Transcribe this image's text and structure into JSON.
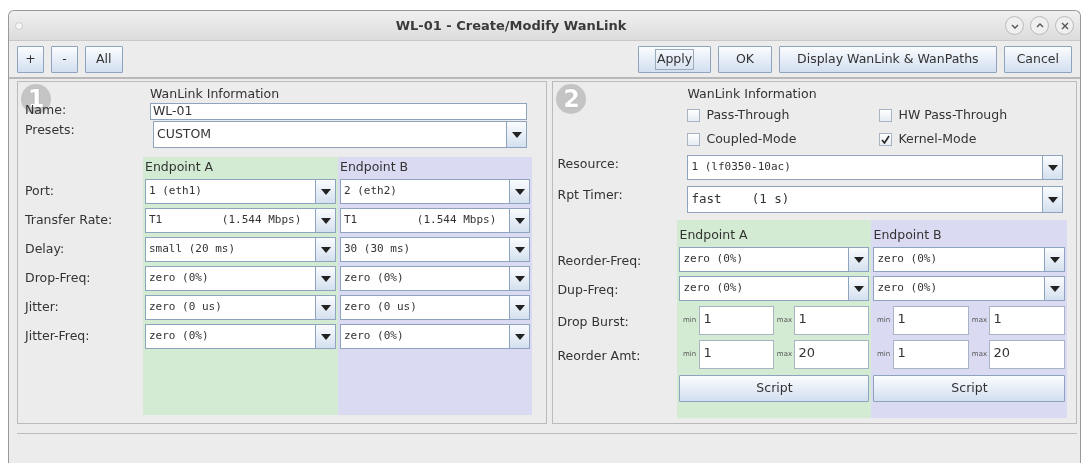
{
  "window": {
    "title": "WL-01 - Create/Modify WanLink"
  },
  "toolbar": {
    "left_buttons": [
      "+",
      "-",
      "All"
    ],
    "right_buttons": [
      {
        "label": "Apply",
        "focused": true
      },
      {
        "label": "OK",
        "focused": false
      },
      {
        "label": "Display WanLink & WanPaths",
        "focused": false
      },
      {
        "label": "Cancel",
        "focused": false
      }
    ]
  },
  "panel_1": {
    "step": "1",
    "heading": "WanLink Information",
    "name": {
      "label": "Name:",
      "value": "WL-01"
    },
    "presets": {
      "label": "Presets:",
      "value": "CUSTOM"
    },
    "endpoints": [
      "Endpoint A",
      "Endpoint B"
    ],
    "rows": [
      {
        "label": "Port:",
        "a": "1 (eth1)",
        "b": "2 (eth2)"
      },
      {
        "label": "Transfer Rate:",
        "a": "T1         (1.544 Mbps)",
        "b": "T1         (1.544 Mbps)"
      },
      {
        "label": "Delay:",
        "a": "small (20 ms)",
        "b": "30 (30 ms)"
      },
      {
        "label": "Drop-Freq:",
        "a": "zero (0%)",
        "b": "zero (0%)"
      },
      {
        "label": "Jitter:",
        "a": "zero (0 us)",
        "b": "zero (0 us)"
      },
      {
        "label": "Jitter-Freq:",
        "a": "zero (0%)",
        "b": "zero (0%)"
      }
    ]
  },
  "panel_2": {
    "step": "2",
    "heading": "WanLink Information",
    "checkboxes": [
      {
        "label": "Pass-Through",
        "checked": false
      },
      {
        "label": "HW Pass-Through",
        "checked": false
      },
      {
        "label": "Coupled-Mode",
        "checked": false
      },
      {
        "label": "Kernel-Mode",
        "checked": true
      }
    ],
    "resource": {
      "label": "Resource:",
      "value": "1 (lf0350-10ac)"
    },
    "rpt_timer": {
      "label": "Rpt Timer:",
      "value": "fast    (1 s)"
    },
    "endpoints": [
      "Endpoint A",
      "Endpoint B"
    ],
    "select_rows": [
      {
        "label": "Reorder-Freq:",
        "a": "zero (0%)",
        "b": "zero (0%)"
      },
      {
        "label": "Dup-Freq:",
        "a": "zero (0%)",
        "b": "zero (0%)"
      }
    ],
    "range_rows": [
      {
        "label": "Drop Burst:",
        "a": {
          "min_label": "min",
          "min": "1",
          "max_label": "max",
          "max": "1"
        },
        "b": {
          "min_label": "min",
          "min": "1",
          "max_label": "max",
          "max": "1"
        }
      },
      {
        "label": "Reorder Amt:",
        "a": {
          "min_label": "min",
          "min": "1",
          "max_label": "max",
          "max": "20"
        },
        "b": {
          "min_label": "min",
          "min": "1",
          "max_label": "max",
          "max": "20"
        }
      }
    ],
    "script_buttons": [
      "Script",
      "Script"
    ]
  }
}
